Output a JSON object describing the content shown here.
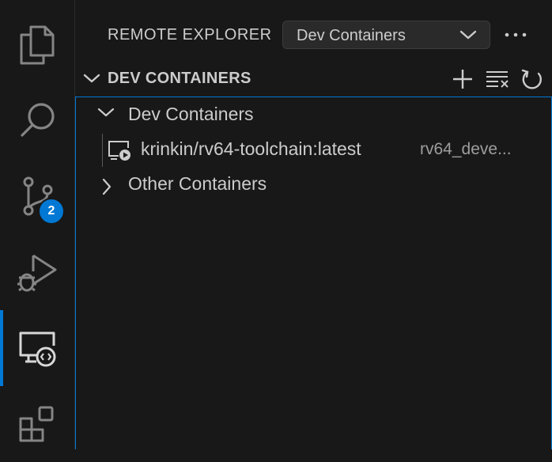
{
  "activity_bar": {
    "items": [
      {
        "name": "explorer-icon"
      },
      {
        "name": "search-icon"
      },
      {
        "name": "source-control-icon",
        "badge": "2"
      },
      {
        "name": "run-debug-icon"
      },
      {
        "name": "remote-explorer-icon",
        "active": true
      },
      {
        "name": "extensions-icon"
      }
    ],
    "accent": "#0078d4"
  },
  "sidebar": {
    "title": "REMOTE EXPLORER",
    "dropdown": {
      "value": "Dev Containers"
    },
    "more_icon": "ellipsis-icon"
  },
  "section": {
    "title": "DEV CONTAINERS",
    "actions": [
      "add-icon",
      "clear-all-icon",
      "refresh-icon"
    ]
  },
  "tree": {
    "groups": [
      {
        "label": "Dev Containers",
        "expanded": true,
        "children": [
          {
            "label": "krinkin/rv64-toolchain:latest",
            "description": "rv64_deve...",
            "icon": "container-running-icon"
          }
        ]
      },
      {
        "label": "Other Containers",
        "expanded": false
      }
    ]
  }
}
